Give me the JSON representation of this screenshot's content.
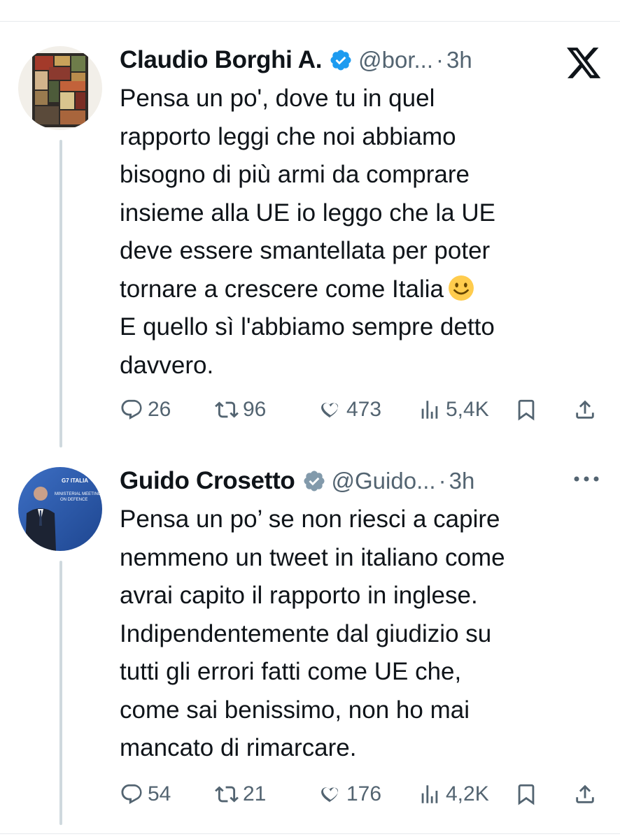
{
  "tweets": [
    {
      "author_name": "Claudio Borghi A.",
      "handle": "@bor...",
      "separator": "·",
      "time": "3h",
      "body": "Pensa un po', dove tu in quel\nrapporto leggi che noi abbiamo\nbisogno di più armi da comprare\ninsieme alla UE io leggo che la UE\ndeve essere smantellata per poter\ntornare a crescere come Italia",
      "body_cont": "E quello sì l'abbiamo sempre detto\ndavvero.",
      "replies": "26",
      "reposts": "96",
      "likes": "473",
      "views": "5,4K",
      "verified_color": "#1d9bf0",
      "top_right_icon": "x-logo-icon"
    },
    {
      "author_name": "Guido Crosetto",
      "handle": "@Guido...",
      "separator": "·",
      "time": "3h",
      "body": "Pensa un po’ se non riesci a capire\nnemmeno un tweet in italiano come\navrai capito il rapporto in inglese.\nIndipendentemente dal giudizio su\ntutti gli errori fatti come UE che,\ncome sai benissimo, non ho mai\nmancato di rimarcare.",
      "replies": "54",
      "reposts": "21",
      "likes": "176",
      "views": "4,2K",
      "verified_color": "#829aab",
      "top_right_icon": "more-options-icon"
    }
  ],
  "avatar2_text": [
    "G7 ITALIA",
    "MINISTERIAL MEETING",
    "ON DEFENCE"
  ],
  "icons": [
    "reply-icon",
    "repost-icon",
    "like-icon",
    "views-icon",
    "bookmark-icon",
    "share-icon",
    "smiley-emoji-icon"
  ]
}
